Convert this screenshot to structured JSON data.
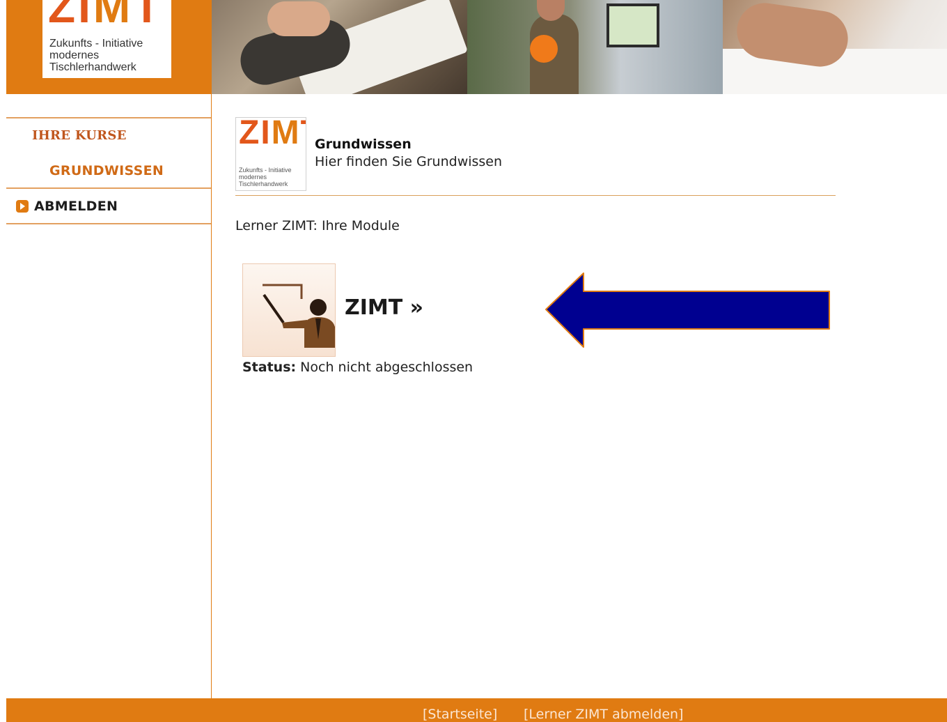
{
  "header": {
    "logo": {
      "letters_part1": "ZI",
      "letters_part2": "M",
      "letters_part3": "T",
      "tagline": [
        "Zukunfts - Initiative",
        "modernes",
        "Tischlerhandwerk"
      ]
    }
  },
  "sidebar": {
    "items": [
      {
        "label": "IHRE KURSE"
      },
      {
        "label": "GRUNDWISSEN"
      },
      {
        "label": "ABMELDEN",
        "icon": "arrow-bullet-icon"
      }
    ]
  },
  "course": {
    "logo_tagline": [
      "Zukunfts - Initiative",
      "modernes",
      "Tischlerhandwerk"
    ],
    "title": "Grundwissen",
    "subtitle": "Hier finden Sie Grundwissen"
  },
  "modules": {
    "heading": "Lerner ZIMT: Ihre Module",
    "items": [
      {
        "icon": "teacher-presentation-icon",
        "link_label": "ZIMT »",
        "status_label": "Status:",
        "status_value": "Noch nicht abgeschlossen"
      }
    ]
  },
  "annotation": {
    "icon": "pointer-arrow-icon",
    "color": "#000090"
  },
  "footer": {
    "links": [
      {
        "label": "[Startseite]"
      },
      {
        "label": "[Lerner ZIMT abmelden]"
      }
    ]
  },
  "colors": {
    "accent": "#e07b12",
    "logo_red": "#e2571b"
  }
}
